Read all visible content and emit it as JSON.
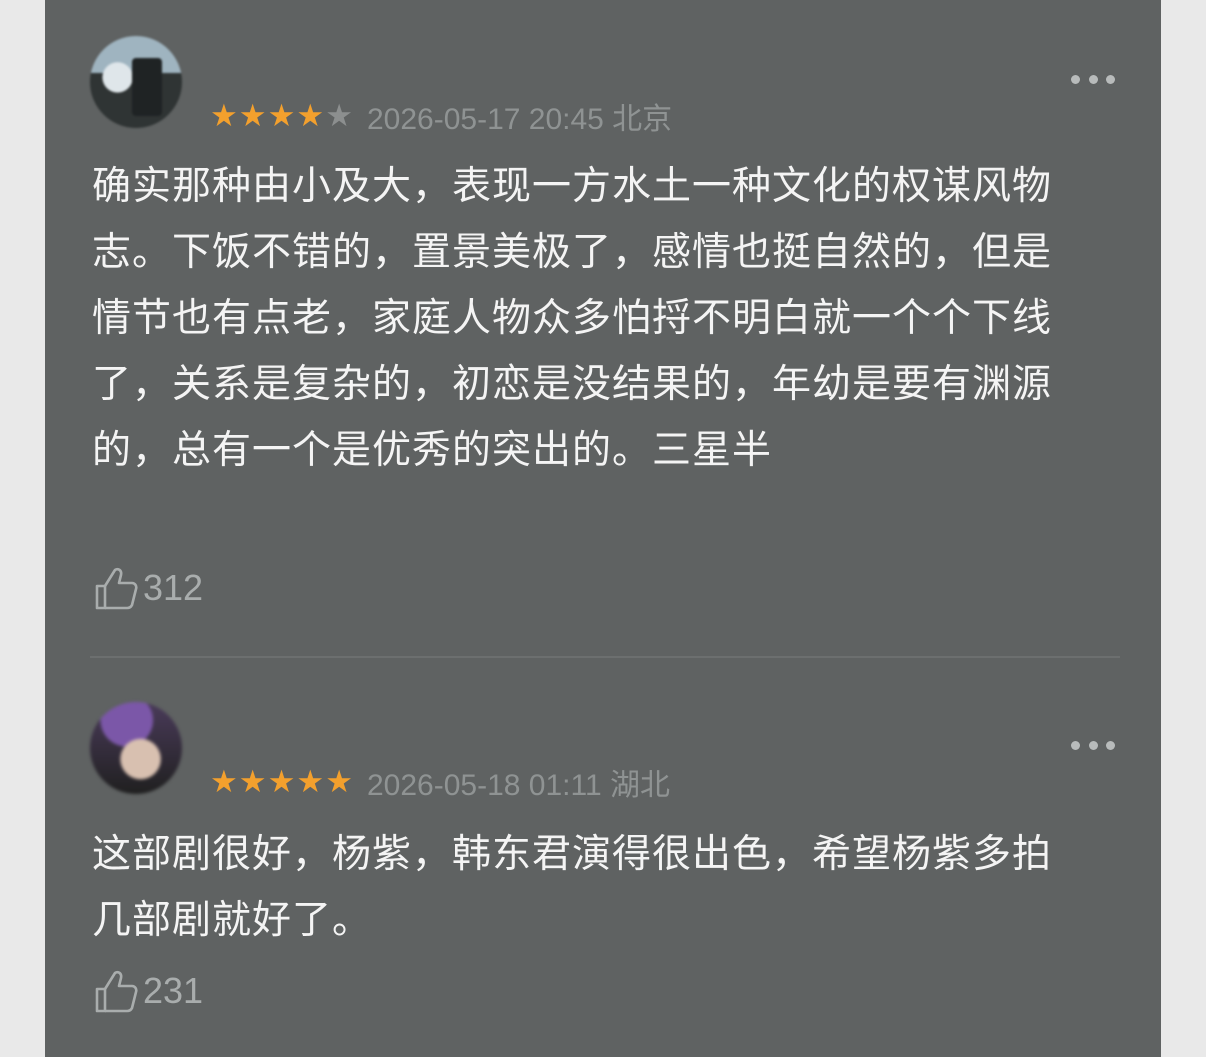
{
  "reviews": [
    {
      "username": "",
      "rating": 4,
      "max_rating": 5,
      "date": "2026-05-17 20:45 北京",
      "content": "确实那种由小及大，表现一方水土一种文化的权谋风物志。下饭不错的，置景美极了，感情也挺自然的，但是情节也有点老，家庭人物众多怕捋不明白就一个个下线了，关系是复杂的，初恋是没结果的，年幼是要有渊源的，总有一个是优秀的突出的。三星半",
      "likes": "312"
    },
    {
      "username": "",
      "rating": 5,
      "max_rating": 5,
      "date": "2026-05-18 01:11 湖北",
      "content": "这部剧很好，杨紫，韩东君演得很出色，希望杨紫多拍几部剧就好了。",
      "likes": "231"
    }
  ],
  "icons": {
    "more": "more-dots-icon",
    "like": "thumbs-up-icon",
    "star": "star-icon"
  },
  "colors": {
    "background": "#5f6262",
    "star_on": "#f3a02d",
    "star_off": "#8c8f8f"
  }
}
